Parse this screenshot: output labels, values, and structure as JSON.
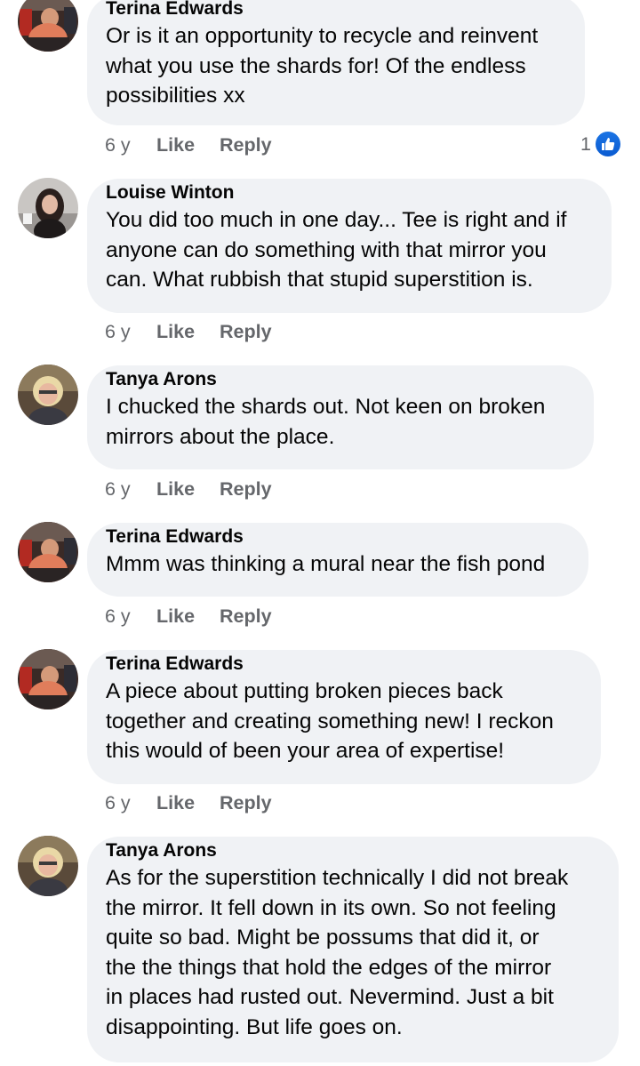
{
  "comments": [
    {
      "author": "Terina Edwards",
      "text": "Or is it an opportunity to recycle and reinvent\nwhat you use the shards for! Of the endless\npossibilities xx",
      "time": "6 y",
      "like": "Like",
      "reply": "Reply",
      "reaction_count": "1"
    },
    {
      "author": "Louise Winton",
      "text": "You did too much in one day... Tee is right and if\nanyone can do something with that mirror you\ncan.    What rubbish that stupid superstition is.",
      "time": "6 y",
      "like": "Like",
      "reply": "Reply"
    },
    {
      "author": "Tanya Arons",
      "text": "I chucked the shards out.  Not keen on broken\nmirrors about the place.",
      "time": "6 y",
      "like": "Like",
      "reply": "Reply"
    },
    {
      "author": "Terina Edwards",
      "text": "Mmm was thinking a mural near the fish pond",
      "time": "6 y",
      "like": "Like",
      "reply": "Reply"
    },
    {
      "author": "Terina Edwards",
      "text": "A piece about putting broken pieces back\ntogether and creating something new! I reckon\nthis would of been your area of expertise!",
      "time": "6 y",
      "like": "Like",
      "reply": "Reply"
    },
    {
      "author": "Tanya Arons",
      "text": "As for the superstition technically I did not break\nthe mirror.  It fell down in its own.  So not feeling\nquite so bad.  Might be possums that did it, or\nthe the things that hold the edges of the mirror\nin places had rusted out.  Nevermind.  Just a bit\ndisappointing.  But life goes on."
    }
  ],
  "icons": {
    "reaction": "like-thumb-icon",
    "avatar": "profile-photo"
  },
  "colors": {
    "bubble": "#f0f2f5",
    "meta": "#65676b",
    "like_blue": "#1b74e4"
  }
}
